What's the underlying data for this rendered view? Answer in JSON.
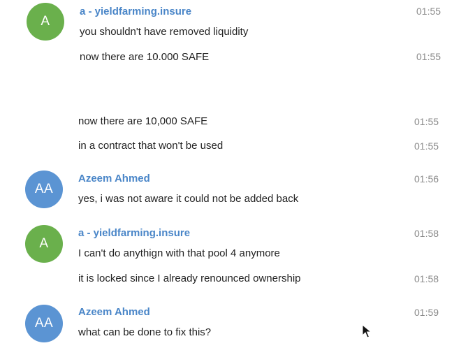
{
  "colors": {
    "avatar_green": "#6ab04c",
    "avatar_blue": "#5b94d3",
    "sender_link": "#4a86c8",
    "timestamp": "#8a8a8a",
    "message_text": "#222222"
  },
  "messages": [
    {
      "avatar": {
        "initials": "A",
        "color": "green"
      },
      "sender": "a - yieldfarming.insure",
      "time": "01:55",
      "lines": [
        {
          "text": "you shouldn't have removed liquidity",
          "time": ""
        }
      ]
    },
    {
      "lines": [
        {
          "text": "now there are 10.000 SAFE",
          "time": "01:55"
        }
      ]
    },
    {
      "lines": [
        {
          "text": "now there are 10,000 SAFE",
          "time": "01:55"
        },
        {
          "text": "in a contract that won't be used",
          "time": "01:55"
        }
      ]
    },
    {
      "avatar": {
        "initials": "AA",
        "color": "blue"
      },
      "sender": "Azeem Ahmed",
      "time": "01:56",
      "lines": [
        {
          "text": "yes, i was not aware it could not be added back",
          "time": ""
        }
      ]
    },
    {
      "avatar": {
        "initials": "A",
        "color": "green"
      },
      "sender": "a - yieldfarming.insure",
      "time": "01:58",
      "lines": [
        {
          "text": "I can't do anythign with that pool 4 anymore",
          "time": ""
        },
        {
          "text": "it is locked since I already renounced ownership",
          "time": "01:58"
        }
      ]
    },
    {
      "avatar": {
        "initials": "AA",
        "color": "blue"
      },
      "sender": "Azeem Ahmed",
      "time": "01:59",
      "lines": [
        {
          "text": "what can be done to fix this?",
          "time": ""
        }
      ]
    }
  ],
  "icons": {
    "cursor": "mouse-pointer-icon"
  }
}
